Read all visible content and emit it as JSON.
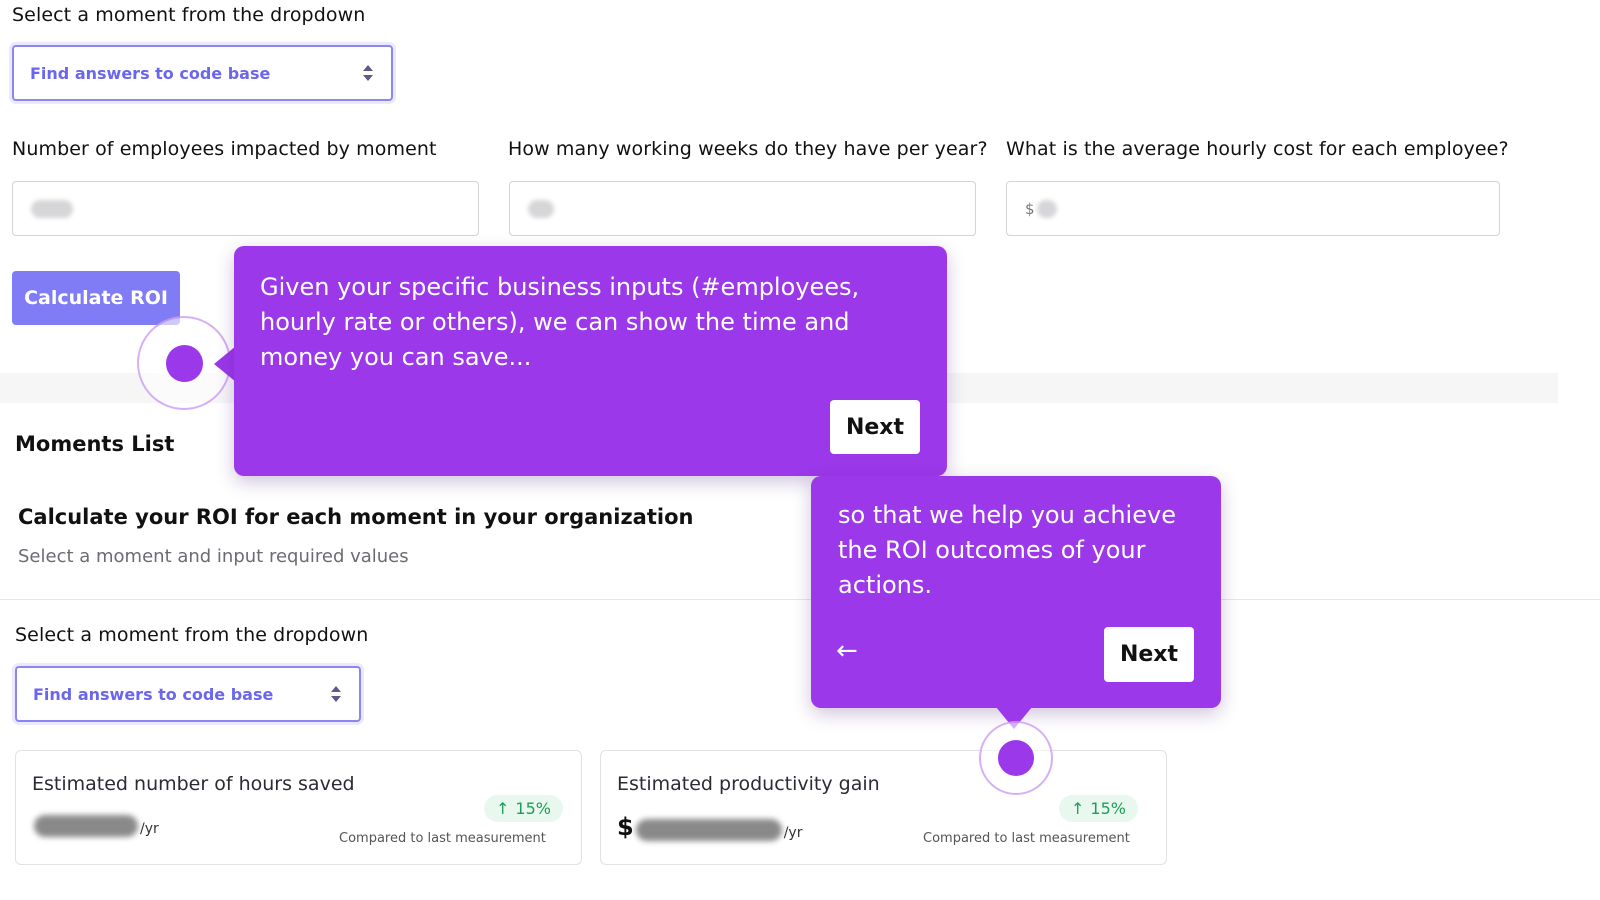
{
  "top": {
    "select_label": "Select a moment from the dropdown",
    "select_value": "Find answers to code base",
    "fields": [
      {
        "label": "Number of employees impacted by moment",
        "prefix": ""
      },
      {
        "label": "How many working weeks do they have per year?",
        "prefix": ""
      },
      {
        "label": "What is the average hourly cost for each employee?",
        "prefix": "$"
      }
    ],
    "calculate_label": "Calculate ROI"
  },
  "moments_list": {
    "title": "Moments List"
  },
  "roi_section": {
    "title": "Calculate your ROI for each moment in your organization",
    "subtitle": "Select a moment and input required values",
    "select_label": "Select a moment from the dropdown",
    "select_value": "Find answers to code base"
  },
  "cards": [
    {
      "title": "Estimated number of hours saved",
      "badge": "15%",
      "prefix": "",
      "unit": "/yr",
      "compare": "Compared to last measurement"
    },
    {
      "title": "Estimated productivity gain",
      "badge": "15%",
      "prefix": "$",
      "unit": "/yr",
      "compare": "Compared to last measurement"
    }
  ],
  "tooltips": [
    {
      "text": "Given your specific business inputs (#employees, hourly rate or others), we can show the time and money you can save...",
      "next_label": "Next"
    },
    {
      "text": "so that we help you achieve the ROI outcomes of your actions.",
      "next_label": "Next",
      "back_icon": "arrow-left-icon"
    }
  ],
  "colors": {
    "accent": "#7f7cf5",
    "tooltip": "#9b38ea",
    "positive": "#1f9d55"
  }
}
